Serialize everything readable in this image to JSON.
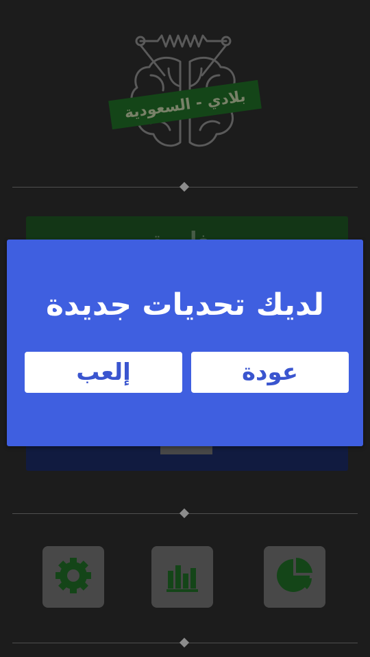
{
  "logo": {
    "icon": "brain-circuit-icon",
    "ribbon_text": "بلادي - السعودية"
  },
  "background": {
    "green_card_text": "مغامرة",
    "tiles": [
      {
        "icon": "gear-icon"
      },
      {
        "icon": "bar-chart-icon"
      },
      {
        "icon": "pie-chart-icon"
      }
    ]
  },
  "dialog": {
    "title": "لديك تحديات جديدة",
    "back_label": "عودة",
    "play_label": "إلعب"
  },
  "colors": {
    "background": "#2b2b2b",
    "dialog": "#3f5fe0",
    "green": "#1e5422",
    "navy": "#1b2a63",
    "icon_green": "#1f6b25"
  }
}
